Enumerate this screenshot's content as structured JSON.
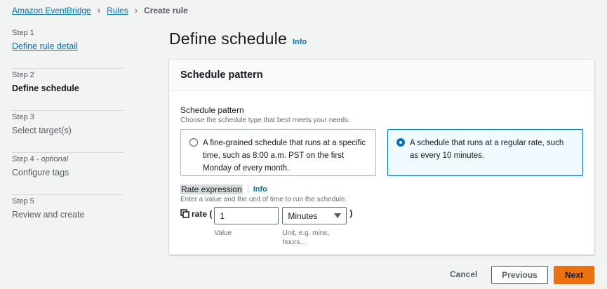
{
  "breadcrumb": {
    "items": [
      "Amazon EventBridge",
      "Rules"
    ],
    "current": "Create rule"
  },
  "steps": [
    {
      "num": "Step 1",
      "title": "Define rule detail",
      "state": "link"
    },
    {
      "num": "Step 2",
      "title": "Define schedule",
      "state": "active"
    },
    {
      "num": "Step 3",
      "title": "Select target(s)",
      "state": "default"
    },
    {
      "num": "Step 4",
      "optional": "optional",
      "title": "Configure tags",
      "state": "default"
    },
    {
      "num": "Step 5",
      "title": "Review and create",
      "state": "default"
    }
  ],
  "page": {
    "title": "Define schedule",
    "info": "Info"
  },
  "panel": {
    "header": "Schedule pattern",
    "field_label": "Schedule pattern",
    "field_desc": "Choose the schedule type that best meets your needs.",
    "tiles": [
      {
        "text": "A fine-grained schedule that runs at a specific time, such as 8:00 a.m. PST on the first Monday of every month.",
        "selected": false
      },
      {
        "text": "A schedule that runs at a regular rate, such as every 10 minutes.",
        "selected": true
      }
    ],
    "rate": {
      "label": "Rate expression",
      "info": "Info",
      "desc": "Enter a value and the unit of time to run the schedule.",
      "prefix": "rate (",
      "suffix": ")",
      "value": "1",
      "value_hint": "Value",
      "unit": "Minutes",
      "unit_hint": "Unit, e.g. mins, hours..."
    }
  },
  "footer": {
    "cancel": "Cancel",
    "previous": "Previous",
    "next": "Next"
  },
  "colors": {
    "link": "#0073bb",
    "primary_button": "#ec7211",
    "background": "#f2f3f3"
  }
}
